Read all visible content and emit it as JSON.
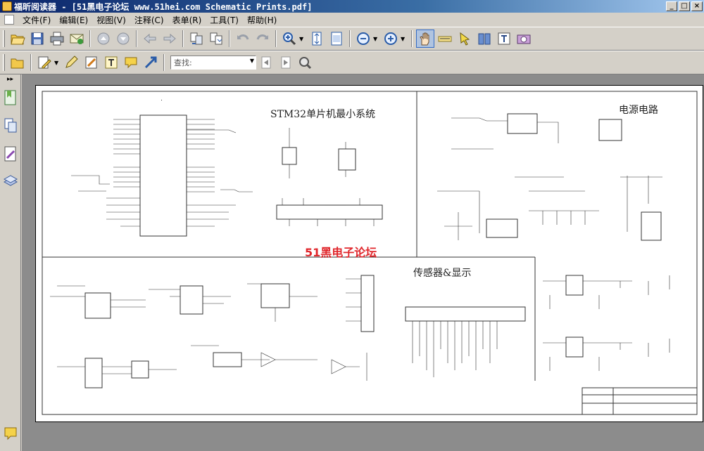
{
  "window": {
    "title": "福昕阅读器 - [51黑电子论坛 www.51hei.com Schematic Prints.pdf]",
    "buttons": {
      "minimize": "_",
      "maximize": "□",
      "close": "×"
    }
  },
  "menu": {
    "items": [
      "文件(F)",
      "编辑(E)",
      "视图(V)",
      "注释(C)",
      "表单(R)",
      "工具(T)",
      "帮助(H)"
    ]
  },
  "toolbar1": {
    "icons": [
      "open-icon",
      "save-icon",
      "print-icon",
      "email-icon",
      "scroll-up-icon",
      "scroll-down-icon",
      "back-icon",
      "forward-icon",
      "rotate-pages-icon",
      "extract-pages-icon",
      "undo-icon",
      "redo-icon",
      "zoom-in-tool-icon",
      "fit-page-icon",
      "fit-width-icon",
      "zoom-out-icon",
      "zoom-in-icon",
      "hand-tool-icon",
      "select-text-icon",
      "select-annotation-icon",
      "snapshot-book-icon",
      "typewriter-icon",
      "camera-icon"
    ]
  },
  "toolbar2": {
    "find_placeholder": "查找:",
    "icons": [
      "open-folder-icon",
      "pencil-icon",
      "highlighter-icon",
      "note-pad-icon",
      "text-box-icon",
      "comment-icon",
      "arrow-icon",
      "find-previous-icon",
      "find-next-icon",
      "search-binoculars-icon"
    ]
  },
  "sidebar": {
    "collapse": "▸▸",
    "icons": [
      "bookmark-icon",
      "pages-icon",
      "annotations-icon",
      "layers-icon",
      "comments-panel-icon"
    ]
  },
  "document": {
    "sections": {
      "mcu": "STM32单片机最小系统",
      "power": "电源电路",
      "sensor": "传感器&显示"
    },
    "watermark": "51黑电子论坛"
  },
  "colors": {
    "titlebar_start": "#0a246a",
    "titlebar_end": "#a6caf0",
    "window_face": "#d4d0c8",
    "viewport_bg": "#8c8c8c",
    "watermark": "#e0262b"
  }
}
